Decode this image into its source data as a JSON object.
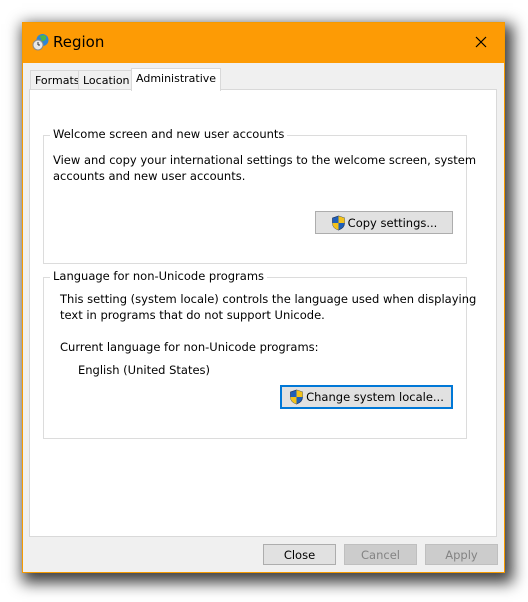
{
  "window": {
    "title": "Region",
    "accent_color": "#fd9b05",
    "icons": {
      "app": "globe-clock-icon",
      "close": "close-icon"
    }
  },
  "tabs": [
    {
      "label": "Formats",
      "active": false
    },
    {
      "label": "Location",
      "active": false
    },
    {
      "label": "Administrative",
      "active": true
    }
  ],
  "welcome_group": {
    "title": "Welcome screen and new user accounts",
    "description_line1": "View and copy your international settings to the welcome screen, system",
    "description_line2": "accounts and new user accounts.",
    "button_label": "Copy settings...",
    "button_icon": "uac-shield-icon"
  },
  "language_group": {
    "title": "Language for non-Unicode programs",
    "description_line1": "This setting (system locale) controls the language used when displaying",
    "description_line2": "text in programs that do not support Unicode.",
    "current_label": "Current language for non-Unicode programs:",
    "current_value": "English (United States)",
    "button_label": "Change system locale...",
    "button_icon": "uac-shield-icon"
  },
  "footer": {
    "close_label": "Close",
    "cancel_label": "Cancel",
    "apply_label": "Apply"
  }
}
